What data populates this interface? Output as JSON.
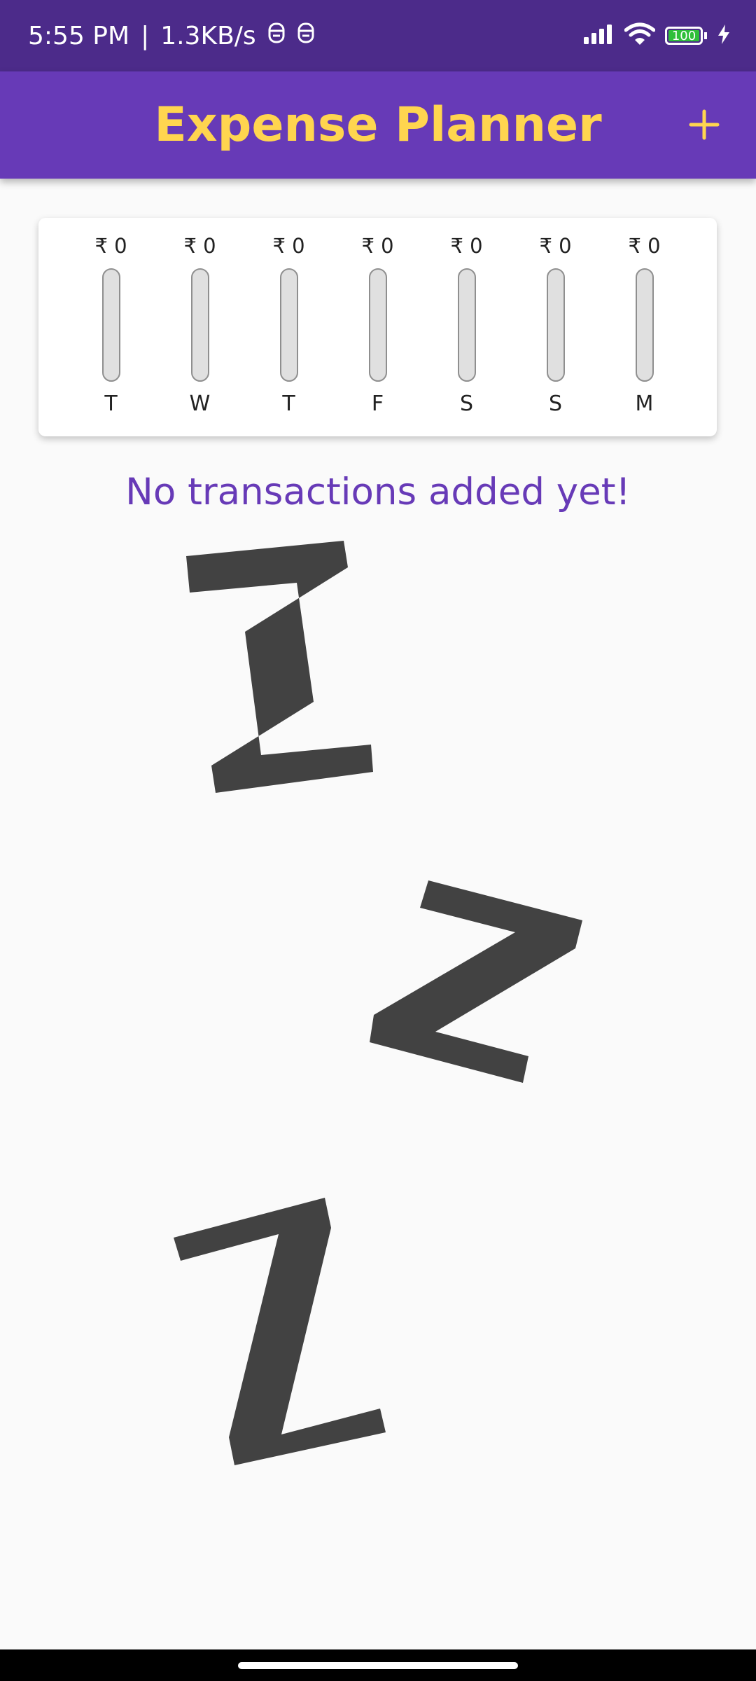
{
  "status_bar": {
    "time": "5:55 PM",
    "separator": "|",
    "network_speed": "1.3KB/s",
    "battery_level": "100",
    "notification_icons": [
      "notification-icon",
      "notification-icon"
    ],
    "system_icons": [
      "cellular-signal-icon",
      "wifi-icon",
      "battery-icon",
      "charging-icon"
    ]
  },
  "app_bar": {
    "title": "Expense Planner",
    "add_button_icon": "plus-icon"
  },
  "colors": {
    "primary": "#673ab7",
    "status_bar": "#4c2b8a",
    "accent": "#ffd54f",
    "bar_track": "#e0e0e0",
    "illustration": "#424242",
    "background": "#fafafa"
  },
  "chart_data": {
    "type": "bar",
    "categories": [
      "T",
      "W",
      "T",
      "F",
      "S",
      "S",
      "M"
    ],
    "values": [
      0,
      0,
      0,
      0,
      0,
      0,
      0
    ],
    "labels": [
      "₹ 0",
      "₹ 0",
      "₹ 0",
      "₹ 0",
      "₹ 0",
      "₹ 0",
      "₹ 0"
    ],
    "title": "",
    "xlabel": "",
    "ylabel": "",
    "fill_fraction": [
      0,
      0,
      0,
      0,
      0,
      0,
      0
    ]
  },
  "empty_state": {
    "message": "No transactions added yet!",
    "illustration_icon": "sleep-zzz-icon"
  }
}
